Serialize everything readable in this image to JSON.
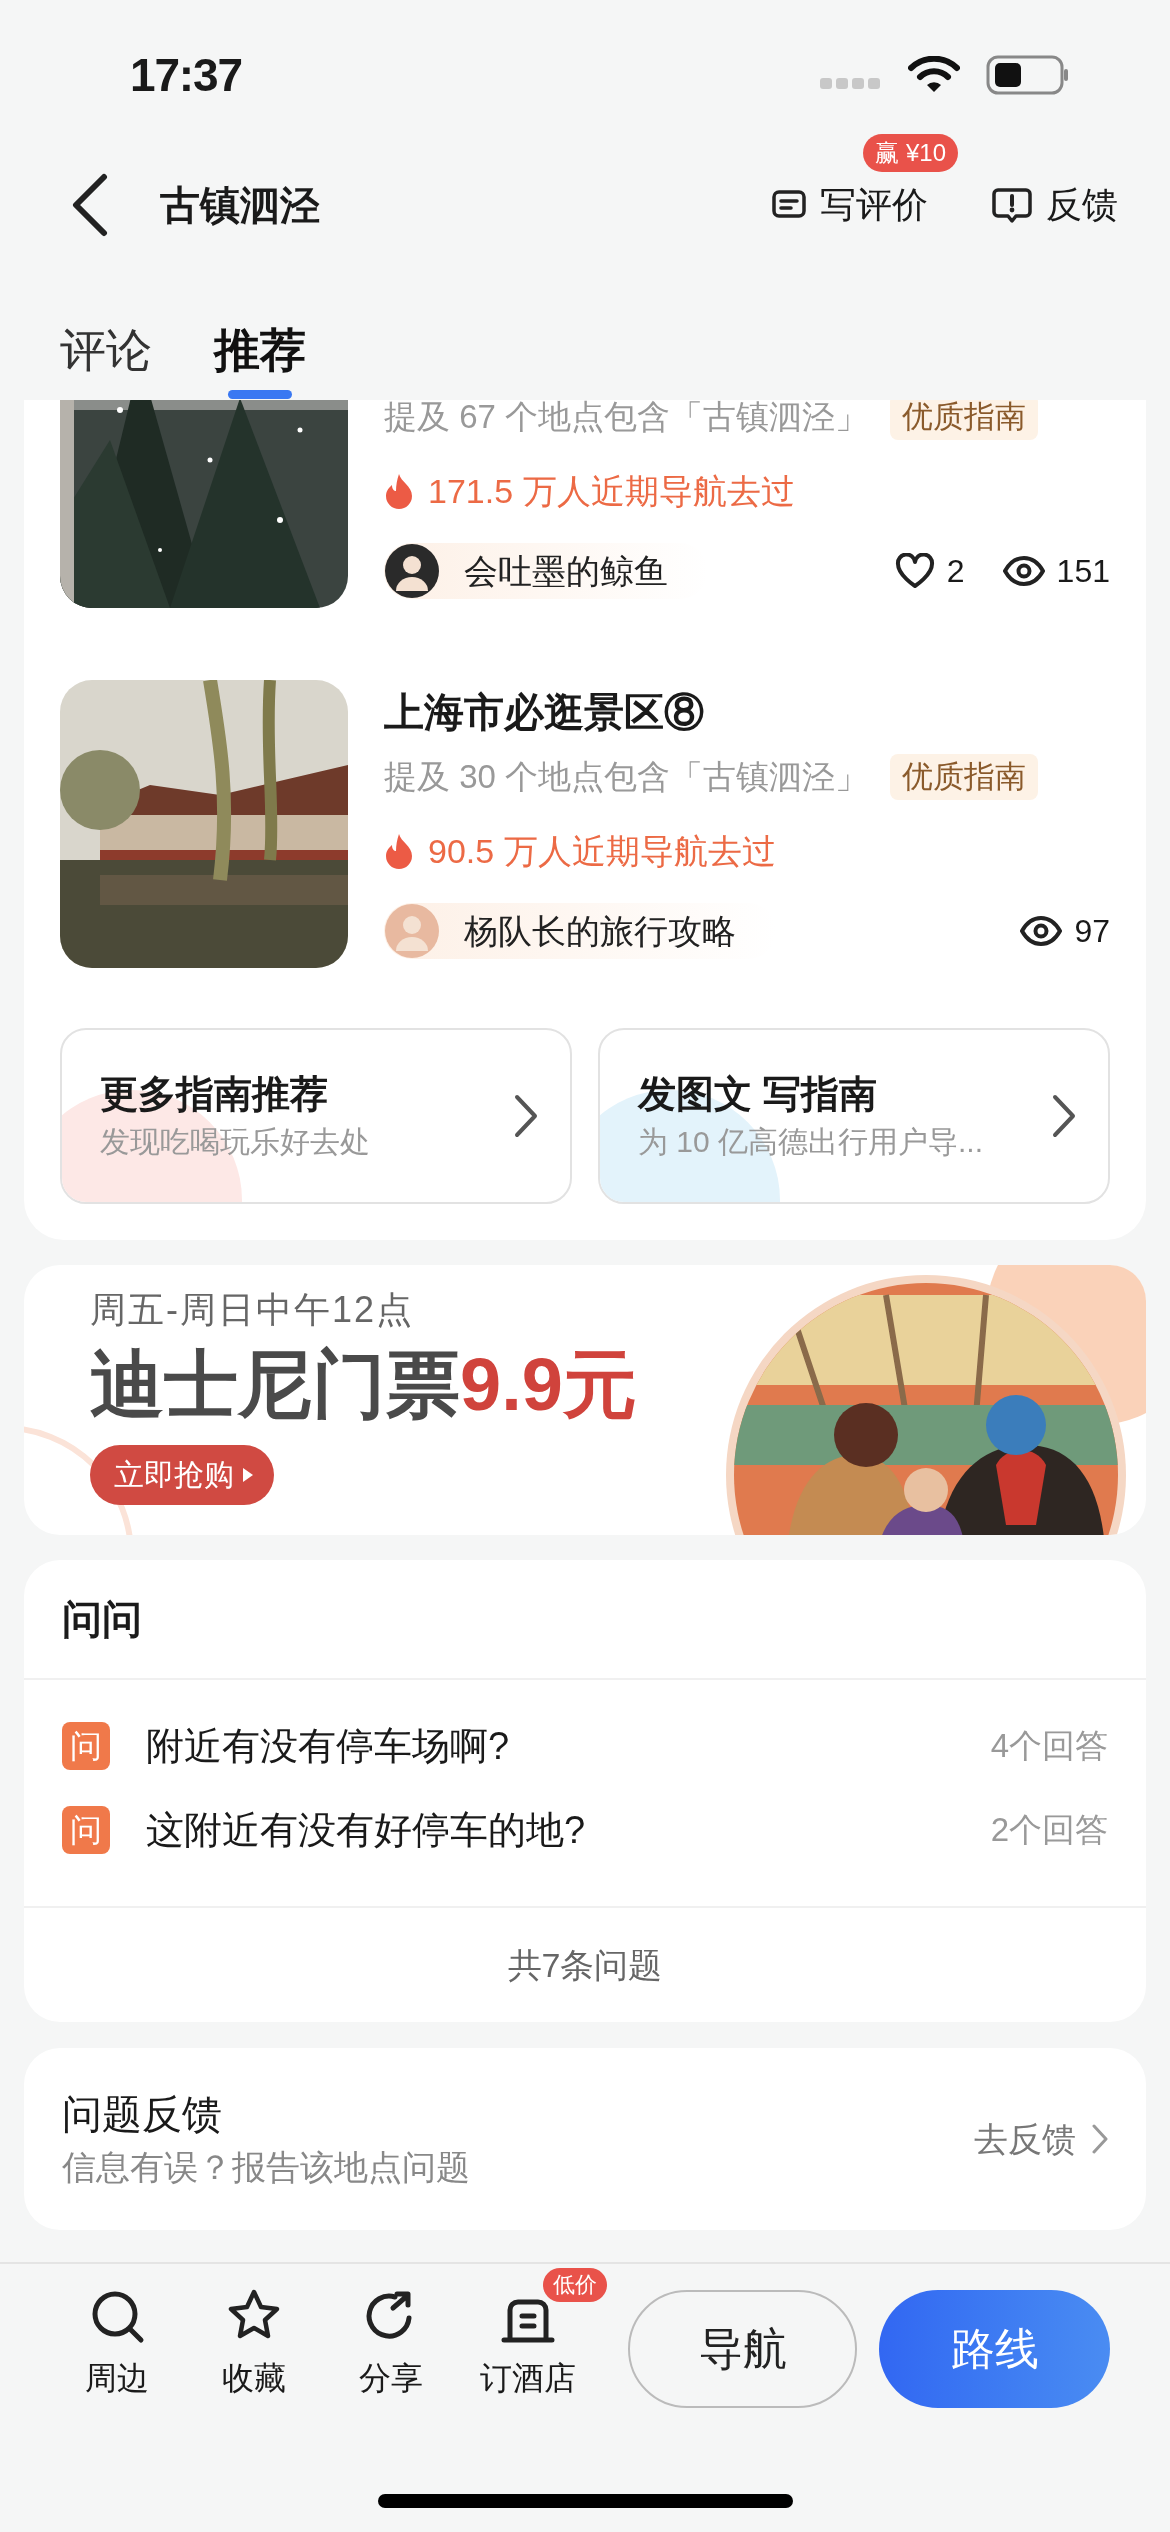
{
  "status_bar": {
    "time": "17:37"
  },
  "header": {
    "title": "古镇泗泾",
    "review": {
      "label": "写评价",
      "badge": "赢 ¥10"
    },
    "feedback": {
      "label": "反馈"
    }
  },
  "tabs": [
    {
      "label": "评论",
      "selected": false
    },
    {
      "label": "推荐",
      "selected": true
    }
  ],
  "guides": [
    {
      "mention": "提及 67 个地点包含「古镇泗泾」",
      "tag": "优质指南",
      "hot": "171.5 万人近期导航去过",
      "author": "会吐墨的鲸鱼",
      "likes": "2",
      "views": "151"
    },
    {
      "title": "上海市必逛景区⑧",
      "mention": "提及 30 个地点包含「古镇泗泾」",
      "tag": "优质指南",
      "hot": "90.5 万人近期导航去过",
      "author": "杨队长的旅行攻略",
      "views": "97"
    }
  ],
  "guide_actions": [
    {
      "title": "更多指南推荐",
      "subtitle": "发现吃喝玩乐好去处"
    },
    {
      "title": "发图文 写指南",
      "subtitle": "为 10 亿高德出行用户导..."
    }
  ],
  "banner": {
    "time": "周五-周日中午12点",
    "headline": "迪士尼门票",
    "price": "9.9元",
    "button": "立即抢购"
  },
  "qa": {
    "title": "问问",
    "questions": [
      {
        "icon": "问",
        "text": "附近有没有停车场啊?",
        "answers": "4个回答"
      },
      {
        "icon": "问",
        "text": "这附近有没有好停车的地?",
        "answers": "2个回答"
      }
    ],
    "footer": "共7条问题"
  },
  "report": {
    "title": "问题反馈",
    "subtitle": "信息有误？报告该地点问题",
    "action": "去反馈"
  },
  "bottom_bar": {
    "items": [
      {
        "kind": "search",
        "label": "周边"
      },
      {
        "kind": "star",
        "label": "收藏"
      },
      {
        "kind": "share",
        "label": "分享"
      },
      {
        "kind": "hotel",
        "label": "订酒店",
        "badge": "低价"
      }
    ],
    "navigate": "导航",
    "route": "路线"
  }
}
